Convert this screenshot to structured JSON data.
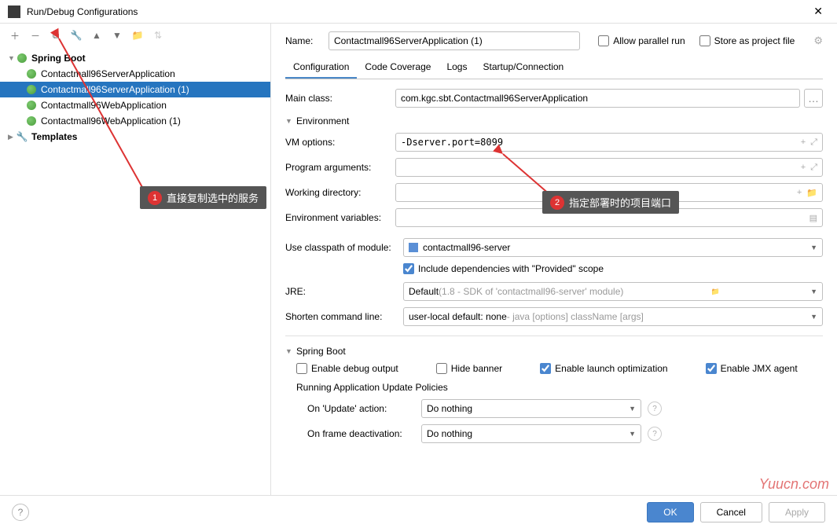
{
  "title": "Run/Debug Configurations",
  "tree": {
    "root": "Spring Boot",
    "items": [
      "Contactmall96ServerApplication",
      "Contactmall96ServerApplication (1)",
      "Contactmall96WebApplication",
      "Contactmall96WebApplication (1)"
    ],
    "templates": "Templates"
  },
  "form": {
    "name_label": "Name:",
    "name_value": "Contactmall96ServerApplication (1)",
    "allow_parallel": "Allow parallel run",
    "store_project": "Store as project file"
  },
  "tabs": [
    "Configuration",
    "Code Coverage",
    "Logs",
    "Startup/Connection"
  ],
  "config": {
    "main_class_label": "Main class:",
    "main_class_value": "com.kgc.sbt.Contactmall96ServerApplication",
    "env_header": "Environment",
    "vm_label": "VM options:",
    "vm_value": "-Dserver.port=8099",
    "args_label": "Program arguments:",
    "workdir_label": "Working directory:",
    "envvar_label": "Environment variables:",
    "classpath_label": "Use classpath of module:",
    "classpath_value": "contactmall96-server",
    "include_deps": "Include dependencies with \"Provided\" scope",
    "jre_label": "JRE:",
    "jre_value_prefix": "Default ",
    "jre_value_gray": "(1.8 - SDK of 'contactmall96-server' module)",
    "shorten_label": "Shorten command line:",
    "shorten_value": "user-local default: none",
    "shorten_gray": " - java [options] className [args]",
    "sb_header": "Spring Boot",
    "chk_debug": "Enable debug output",
    "chk_hide": "Hide banner",
    "chk_launch": "Enable launch optimization",
    "chk_jmx": "Enable JMX agent",
    "policies_label": "Running Application Update Policies",
    "update_label": "On 'Update' action:",
    "update_value": "Do nothing",
    "frame_label": "On frame deactivation:",
    "frame_value": "Do nothing"
  },
  "buttons": {
    "ok": "OK",
    "cancel": "Cancel",
    "apply": "Apply"
  },
  "annotations": {
    "a1": "直接复制选中的服务",
    "a2": "指定部署时的项目端口"
  },
  "watermark": "Yuucn.com"
}
